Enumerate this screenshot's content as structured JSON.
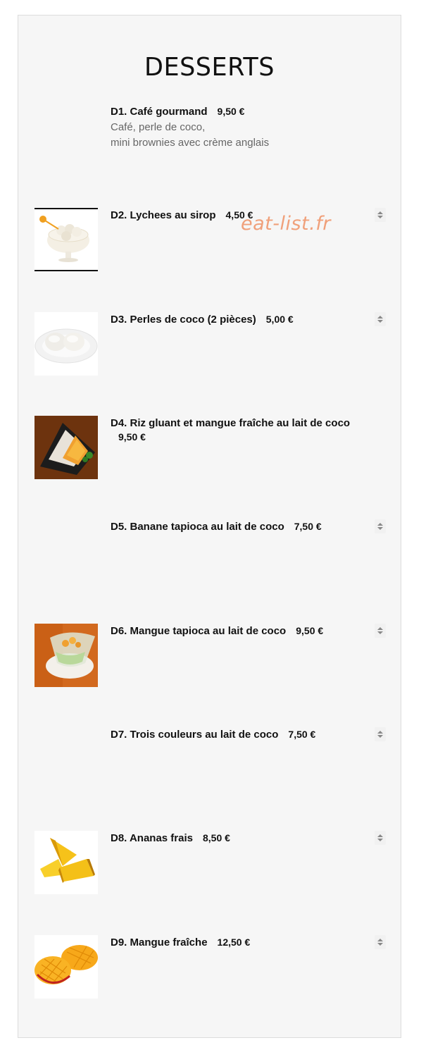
{
  "page": {
    "title": "DESSERTS",
    "watermark": "eat-list.fr"
  },
  "items": [
    {
      "code_name": "D1. Café gourmand",
      "price": "9,50 €",
      "desc_lines": [
        "Café, perle de coco,",
        "mini brownies avec crème anglais"
      ],
      "image": "",
      "has_stepper": false
    },
    {
      "code_name": "D2. Lychees au sirop",
      "price": "4,50 €",
      "image": "lychee-bowl-image",
      "has_stepper": true
    },
    {
      "code_name": "D3. Perles de coco (2 pièces)",
      "price": "5,00 €",
      "image": "coconut-pearls-image",
      "has_stepper": true
    },
    {
      "code_name": "D4. Riz gluant et mangue fraîche au lait de coco",
      "price": "9,50 €",
      "image": "sticky-rice-mango-image",
      "has_stepper": false
    },
    {
      "code_name": "D5. Banane tapioca au lait de coco",
      "price": "7,50 €",
      "image": "",
      "has_stepper": true
    },
    {
      "code_name": "D6. Mangue tapioca au lait de coco",
      "price": "9,50 €",
      "image": "mango-tapioca-image",
      "has_stepper": true
    },
    {
      "code_name": "D7. Trois couleurs au lait de coco",
      "price": "7,50 €",
      "image": "",
      "has_stepper": true
    },
    {
      "code_name": "D8. Ananas frais",
      "price": "8,50 €",
      "image": "pineapple-image",
      "has_stepper": true
    },
    {
      "code_name": "D9. Mangue fraîche",
      "price": "12,50 €",
      "image": "mango-image",
      "has_stepper": true
    }
  ]
}
